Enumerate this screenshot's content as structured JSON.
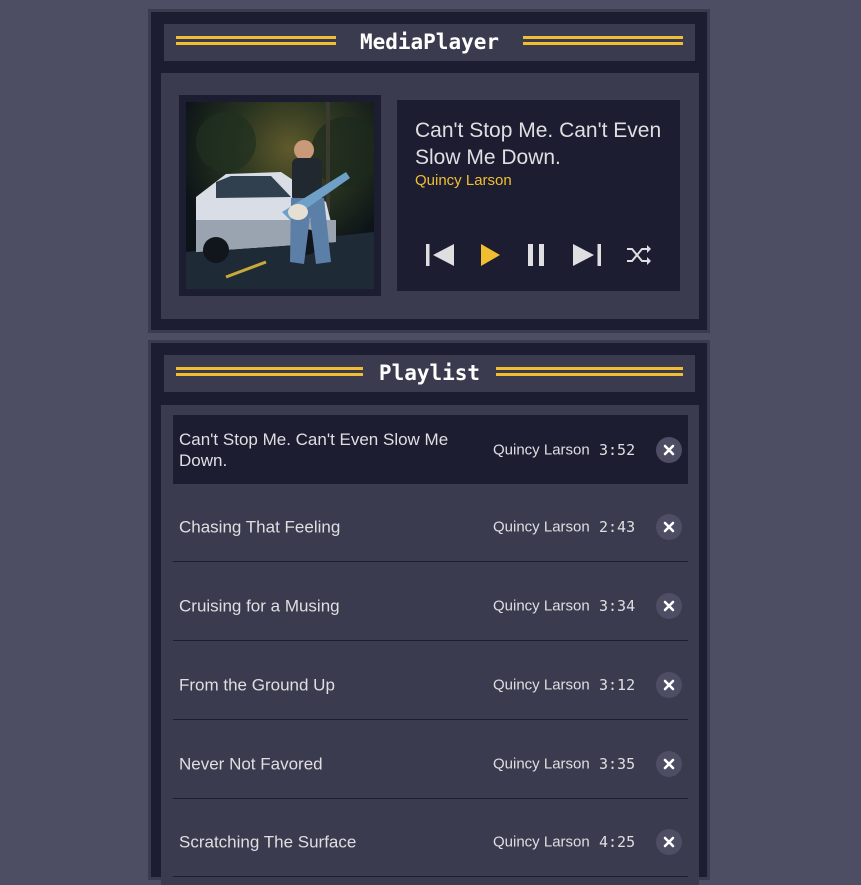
{
  "player": {
    "title": "MediaPlayer",
    "album_art": {
      "icon": "album-art-guitarist-car"
    },
    "now_playing": {
      "title": "Can't Stop Me. Can't Even Slow Me Down.",
      "artist": "Quincy Larson"
    },
    "controls": [
      {
        "name": "previous-button",
        "icon": "skip-previous-icon"
      },
      {
        "name": "play-button",
        "icon": "play-icon"
      },
      {
        "name": "pause-button",
        "icon": "pause-icon"
      },
      {
        "name": "next-button",
        "icon": "skip-next-icon"
      },
      {
        "name": "shuffle-button",
        "icon": "shuffle-icon"
      }
    ]
  },
  "playlist": {
    "title": "Playlist",
    "tracks": [
      {
        "title": "Can't Stop Me. Can't Even Slow Me Down.",
        "artist": "Quincy Larson",
        "duration": "3:52",
        "current": true
      },
      {
        "title": "Chasing That Feeling",
        "artist": "Quincy Larson",
        "duration": "2:43"
      },
      {
        "title": "Cruising for a Musing",
        "artist": "Quincy Larson",
        "duration": "3:34"
      },
      {
        "title": "From the Ground Up",
        "artist": "Quincy Larson",
        "duration": "3:12"
      },
      {
        "title": "Never Not Favored",
        "artist": "Quincy Larson",
        "duration": "3:35"
      },
      {
        "title": "Scratching The Surface",
        "artist": "Quincy Larson",
        "duration": "4:25"
      }
    ]
  },
  "colors": {
    "page_bg": "#4d4d64",
    "panel_dark": "#1d1d32",
    "panel_mid": "#3b3b4f",
    "accent": "#f1be32",
    "text": "#dfdfe2"
  }
}
